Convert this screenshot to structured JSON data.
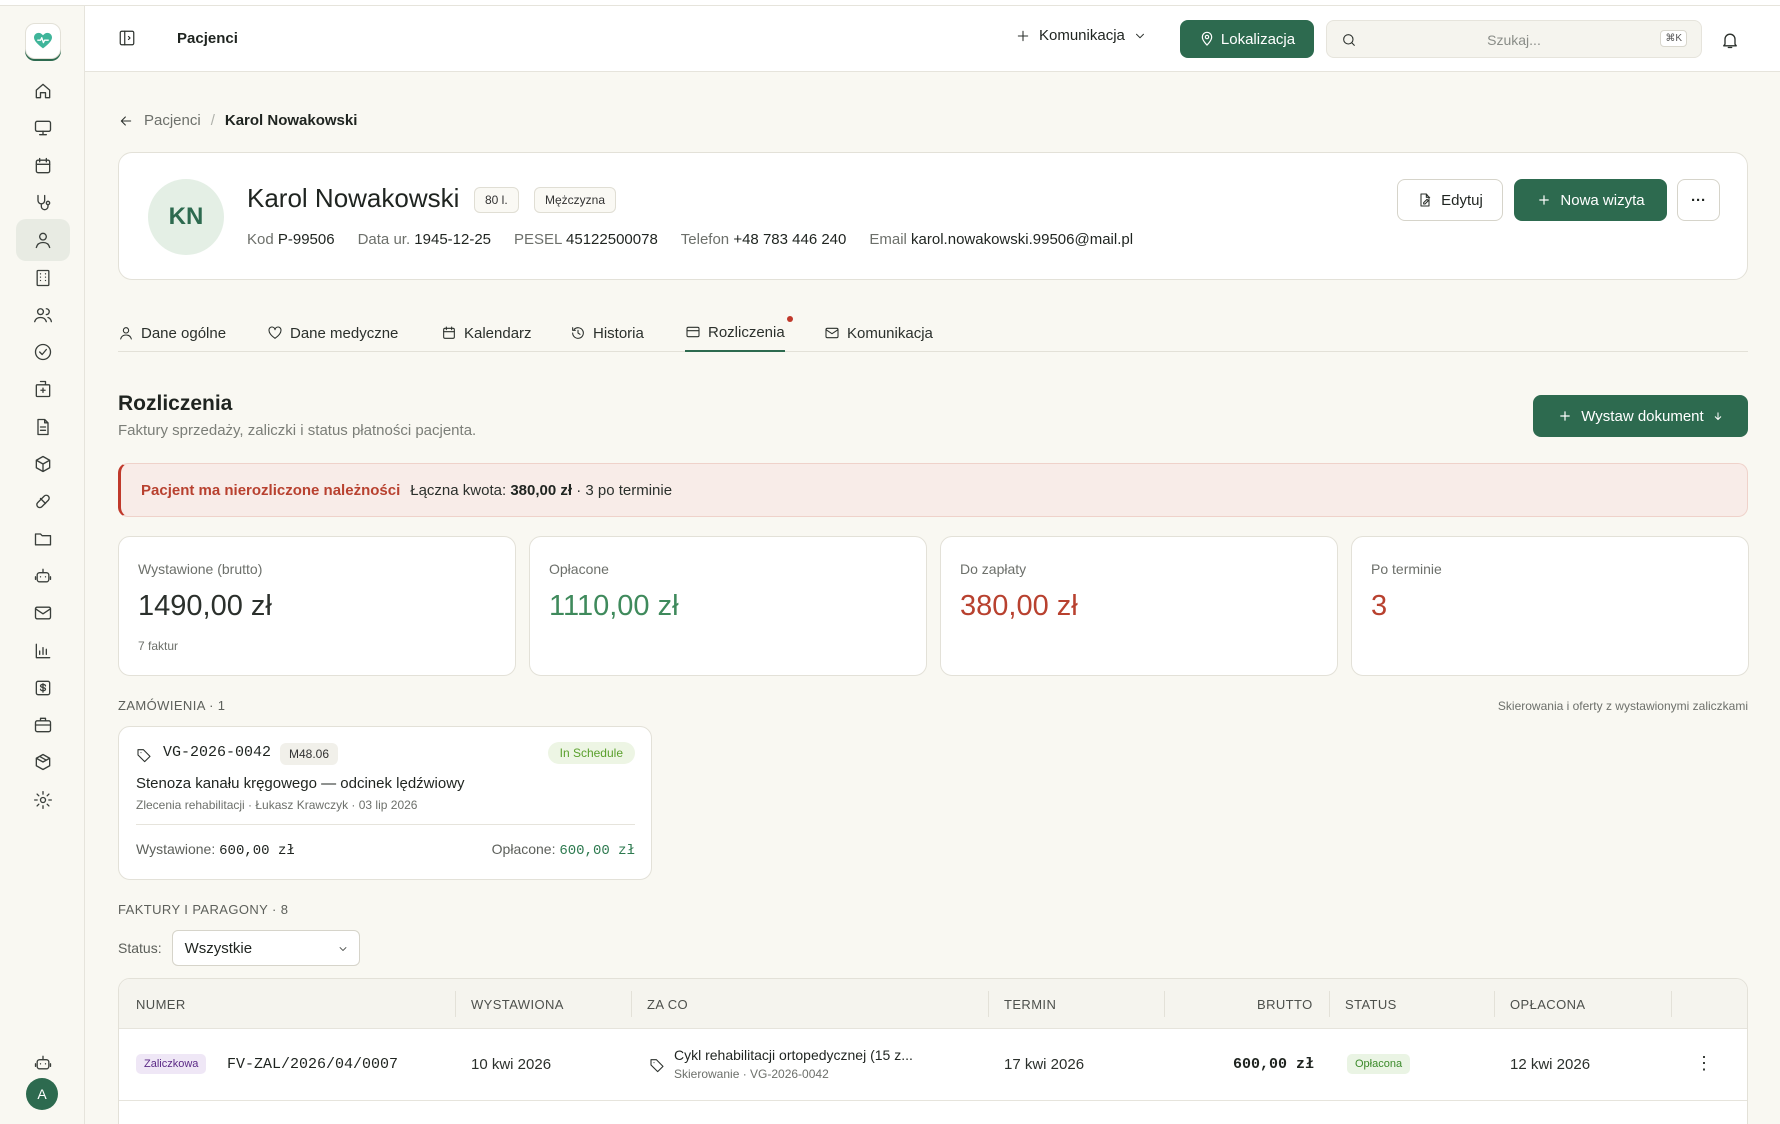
{
  "topbar": {
    "title": "Pacjenci",
    "komunikacja_label": "Komunikacja",
    "lokalizacja_label": "Lokalizacja",
    "search_placeholder": "Szukaj...",
    "search_shortcut": "⌘K"
  },
  "sidebar": {
    "items": [
      "home-icon",
      "monitor-icon",
      "calendar-icon",
      "stethoscope-icon",
      "user-icon",
      "building-icon",
      "users-icon",
      "check-circle-icon",
      "hospital-icon",
      "document-icon",
      "box-icon",
      "pill-icon",
      "folder-icon",
      "robot-icon",
      "mail-icon",
      "chart-icon",
      "invoice-icon",
      "briefcase-icon",
      "package-icon",
      "gear-icon"
    ],
    "active_index": 4,
    "bottom_icon": "robot-icon",
    "user_initial": "A"
  },
  "breadcrumb": {
    "parent": "Pacjenci",
    "separator": "/",
    "current": "Karol Nowakowski"
  },
  "patient": {
    "initials": "KN",
    "name": "Karol Nowakowski",
    "age_badge": "80 l.",
    "gender_badge": "Mężczyzna",
    "meta": [
      {
        "label": "Kod",
        "value": "P-99506"
      },
      {
        "label": "Data ur.",
        "value": "1945-12-25"
      },
      {
        "label": "PESEL",
        "value": "45122500078"
      },
      {
        "label": "Telefon",
        "value": "+48 783 446 240"
      },
      {
        "label": "Email",
        "value": "karol.nowakowski.99506@mail.pl"
      }
    ],
    "edit_label": "Edytuj",
    "new_visit_label": "Nowa wizyta",
    "more_label": "···"
  },
  "tabs": [
    {
      "label": "Dane ogólne",
      "icon": "user-icon"
    },
    {
      "label": "Dane medyczne",
      "icon": "heart-icon"
    },
    {
      "label": "Kalendarz",
      "icon": "calendar-icon"
    },
    {
      "label": "Historia",
      "icon": "history-icon"
    },
    {
      "label": "Rozliczenia",
      "icon": "card-icon",
      "active": true
    },
    {
      "label": "Komunikacja",
      "icon": "mail-icon"
    }
  ],
  "section": {
    "title": "Rozliczenia",
    "subtitle": "Faktury sprzedaży, zaliczki i status płatności pacjenta.",
    "issue_button": "Wystaw dokument"
  },
  "alert": {
    "title": "Pacjent ma nierozliczone należności",
    "total_label": "Łączna kwota:",
    "total_value": "380,00 zł",
    "overdue": "· 3 po terminie"
  },
  "stats": [
    {
      "label": "Wystawione (brutto)",
      "value": "1490,00 zł",
      "sub": "7 faktur",
      "color": "#2b302c"
    },
    {
      "label": "Opłacone",
      "value": "1110,00 zł",
      "sub": "",
      "color": "#3f8a5c"
    },
    {
      "label": "Do zapłaty",
      "value": "380,00 zł",
      "sub": "",
      "color": "#b8412f"
    },
    {
      "label": "Po terminie",
      "value": "3",
      "sub": "",
      "color": "#b8412f"
    }
  ],
  "orders": {
    "heading": "ZAMÓWIENIA · 1",
    "note": "Skierowania i oferty z wystawionymi zaliczkami",
    "item": {
      "code": "VG-2026-0042",
      "icd": "M48.06",
      "status": "In Schedule",
      "description": "Stenoza kanału kręgowego — odcinek lędźwiowy",
      "meta": "Zlecenia rehabilitacji · Łukasz Krawczyk · 03 lip 2026",
      "issued_label": "Wystawione:",
      "issued_value": "600,00 zł",
      "paid_label": "Opłacone:",
      "paid_value": "600,00 zł"
    }
  },
  "invoices": {
    "heading": "FAKTURY I PARAGONY · 8",
    "filter_label": "Status:",
    "filter_value": "Wszystkie",
    "columns": [
      "NUMER",
      "WYSTAWIONA",
      "ZA CO",
      "TERMIN",
      "BRUTTO",
      "STATUS",
      "OPŁACONA"
    ],
    "rows": [
      {
        "type": "Zaliczkowa",
        "number": "FV-ZAL/2026/04/0007",
        "issued": "10 kwi 2026",
        "for": "Cykl rehabilitacji ortopedycznej (15 z...",
        "for_sub": "Skierowanie · VG-2026-0042",
        "due": "17 kwi 2026",
        "gross": "600,00 zł",
        "status": "Opłacona",
        "paid": "12 kwi 2026"
      }
    ]
  }
}
